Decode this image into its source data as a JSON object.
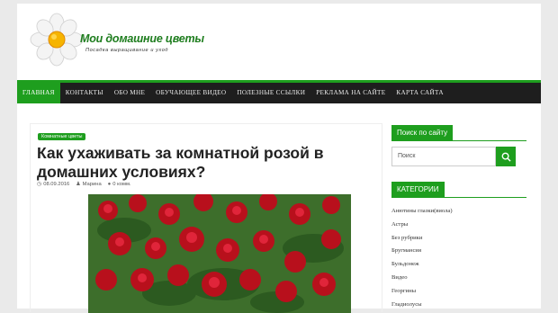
{
  "header": {
    "site_title": "Мои домашние цветы",
    "site_description": "Посадка выращивание и уход"
  },
  "nav": {
    "items": [
      {
        "label": "ГЛАВНАЯ",
        "active": true
      },
      {
        "label": "КОНТАКТЫ",
        "active": false
      },
      {
        "label": "ОБО МНЕ",
        "active": false
      },
      {
        "label": "ОБУЧАЮЩЕЕ ВИДЕО",
        "active": false
      },
      {
        "label": "ПОЛЕЗНЫЕ ССЫЛКИ",
        "active": false
      },
      {
        "label": "РЕКЛАМА НА САЙТЕ",
        "active": false
      },
      {
        "label": "КАРТА САЙТА",
        "active": false
      }
    ]
  },
  "article": {
    "category": "Комнатные цветы",
    "title": "Как ухаживать за комнатной розой в домашних условиях?",
    "date": "08.09.2016",
    "author": "Марина",
    "comments": "0 комм."
  },
  "sidebar": {
    "search_title": "Поиск по сайту",
    "search_placeholder": "Поиск",
    "categories_title": "КАТЕГОРИИ",
    "categories": [
      "Анютины глазки(виола)",
      "Астры",
      "Без рубрики",
      "Бругмансия",
      "Бульдонеж",
      "Видео",
      "Георгины",
      "Гладиолусы"
    ]
  },
  "colors": {
    "accent": "#1e9e1e",
    "nav_bg": "#1e1e1e",
    "title_green": "#1e7d1e"
  }
}
